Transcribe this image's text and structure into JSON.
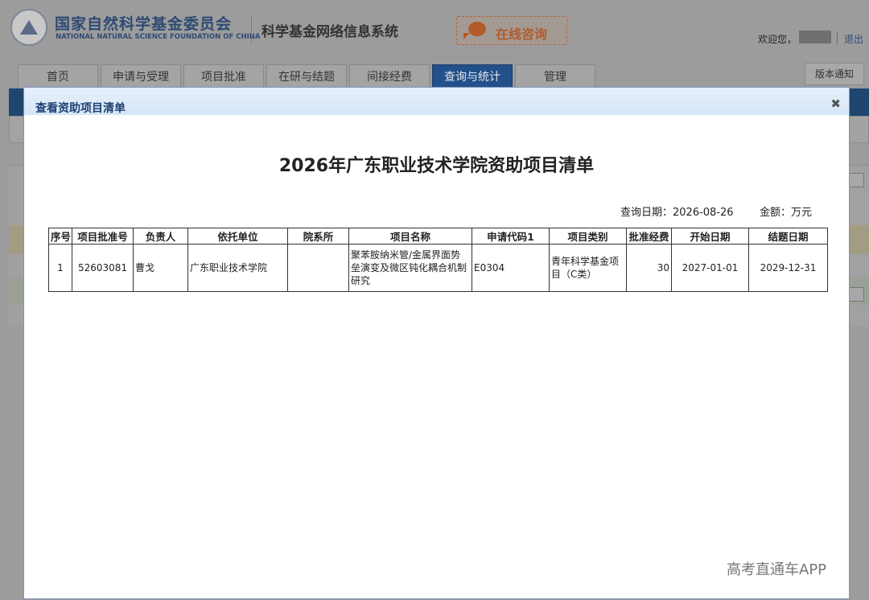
{
  "header": {
    "org_cn": "国家自然科学基金委员会",
    "org_en": "NATIONAL NATURAL SCIENCE FOUNDATION OF CHINA",
    "system_title": "科学基金网络信息系统",
    "consult_label": "在线咨询",
    "welcome_label": "欢迎您，",
    "logout_label": "退出",
    "version_label": "版本通知"
  },
  "nav": {
    "tabs": [
      {
        "label": "首页"
      },
      {
        "label": "申请与受理"
      },
      {
        "label": "项目批准"
      },
      {
        "label": "在研与结题"
      },
      {
        "label": "间接经费"
      },
      {
        "label": "查询与统计",
        "active": true
      },
      {
        "label": "管理"
      }
    ]
  },
  "modal": {
    "title": "查看资助项目清单",
    "close_icon": "close-icon",
    "report_title": "2026年广东职业技术学院资助项目清单",
    "query_date": "查询日期：2026-08-26",
    "amount_unit": "金额：万元",
    "table": {
      "headers": [
        "序号",
        "项目批准号",
        "负责人",
        "依托单位",
        "院系所",
        "项目名称",
        "申请代码1",
        "项目类别",
        "批准经费",
        "开始日期",
        "结题日期"
      ],
      "rows": [
        {
          "index": "1",
          "approval_no": "52603081",
          "pi": "曹戈",
          "institution": "广东职业技术学院",
          "department": "",
          "project_name": "聚苯胺纳米管/金属界面势垒演变及微区钝化耦合机制研究",
          "code": "E0304",
          "category": "青年科学基金项目（C类）",
          "funding": "30",
          "start_date": "2027-01-01",
          "end_date": "2029-12-31"
        }
      ]
    }
  },
  "watermark": "高考直通车APP",
  "colors": {
    "overlay_gray": "#9c9c9c",
    "nav_active": "#22508a",
    "modal_title": "#1d3f73",
    "consult_orange": "#b25a2a"
  }
}
